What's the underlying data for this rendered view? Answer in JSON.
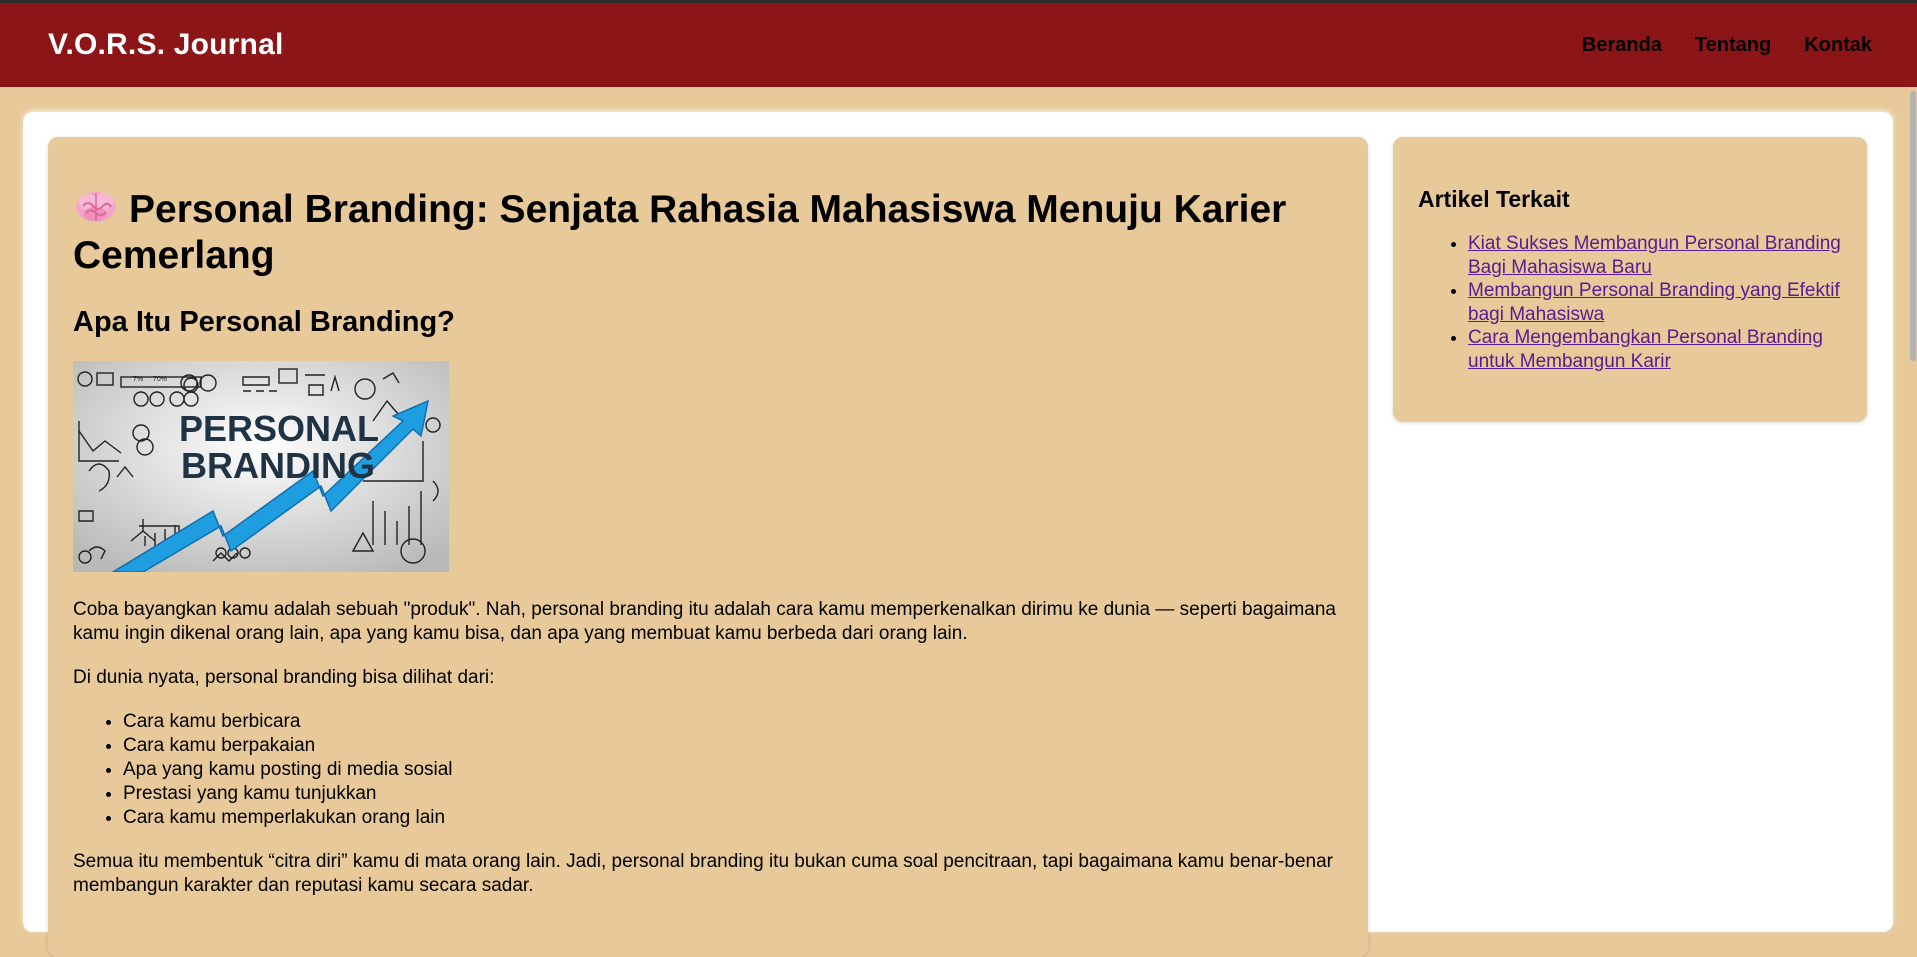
{
  "header": {
    "site_title": "V.O.R.S. Journal",
    "nav": [
      {
        "label": "Beranda"
      },
      {
        "label": "Tentang"
      },
      {
        "label": "Kontak"
      }
    ]
  },
  "article": {
    "title_icon": "brain-icon",
    "title": "Personal Branding: Senjata Rahasia Mahasiswa Menuju Karier Cemerlang",
    "subtitle": "Apa Itu Personal Branding?",
    "image": {
      "main_text_line1": "PERSONAL",
      "main_text_line2": "BRANDING",
      "strip_text1": "7%",
      "strip_text2": "70%"
    },
    "paragraph1": "Coba bayangkan kamu adalah sebuah \"produk\". Nah, personal branding itu adalah cara kamu memperkenalkan dirimu ke dunia — seperti bagaimana kamu ingin dikenal orang lain, apa yang kamu bisa, dan apa yang membuat kamu berbeda dari orang lain.",
    "paragraph2": "Di dunia nyata, personal branding bisa dilihat dari:",
    "bullets": [
      "Cara kamu berbicara",
      "Cara kamu berpakaian",
      "Apa yang kamu posting di media sosial",
      "Prestasi yang kamu tunjukkan",
      "Cara kamu memperlakukan orang lain"
    ],
    "paragraph3": "Semua itu membentuk “citra diri” kamu di mata orang lain. Jadi, personal branding itu bukan cuma soal pencitraan, tapi bagaimana kamu benar-benar membangun karakter dan reputasi kamu secara sadar."
  },
  "sidebar": {
    "heading": "Artikel Terkait",
    "links": [
      {
        "label": "Kiat Sukses Membangun Personal Branding Bagi Mahasiswa Baru"
      },
      {
        "label": "Membangun Personal Branding yang Efektif bagi Mahasiswa"
      },
      {
        "label": "Cara Mengembangkan Personal Branding untuk Membangun Karir"
      }
    ]
  },
  "colors": {
    "header_bg": "#8b1517",
    "page_bg": "#e8c99a",
    "container_bg": "#ffffff",
    "link_color": "#5b1a8f",
    "arrow_blue": "#1e9ee0"
  }
}
